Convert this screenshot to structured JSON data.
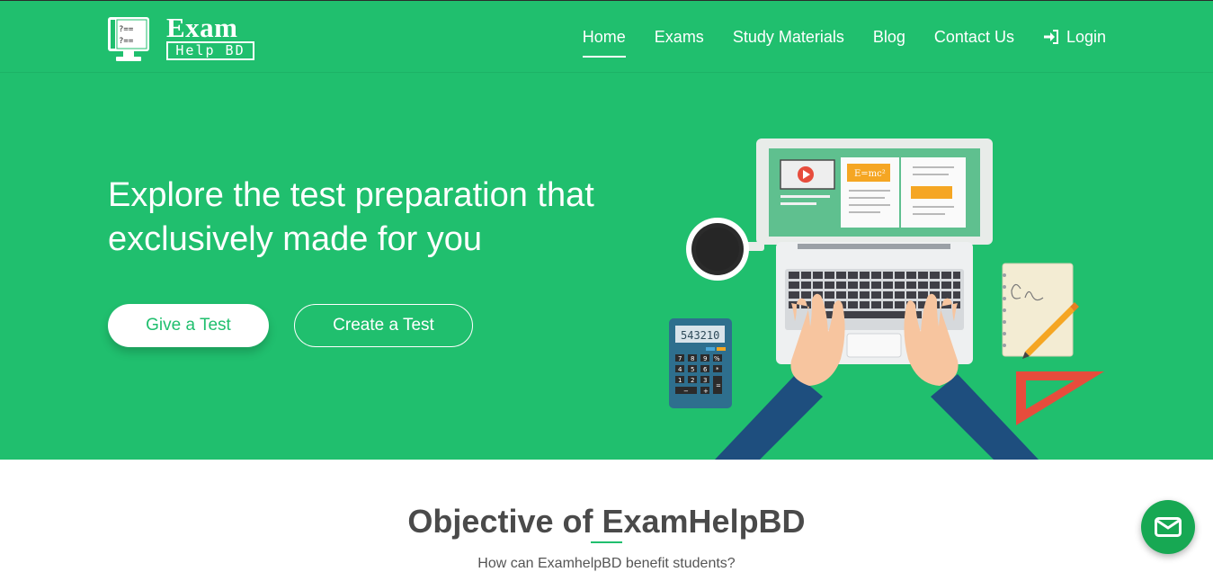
{
  "brand": {
    "word_top": "Exam",
    "word_bottom": "Help BD",
    "primary_color": "#20bf6e"
  },
  "nav": {
    "items": [
      {
        "label": "Home",
        "active": true
      },
      {
        "label": "Exams",
        "active": false
      },
      {
        "label": "Study Materials",
        "active": false
      },
      {
        "label": "Blog",
        "active": false
      },
      {
        "label": "Contact Us",
        "active": false
      }
    ],
    "login_label": "Login",
    "login_icon": "sign-in-icon"
  },
  "hero": {
    "title": "Explore the test preparation that exclusively made for you",
    "give_test_label": "Give a Test",
    "create_test_label": "Create a Test",
    "illustration": {
      "calculator_display": "543210",
      "formula": "E=mc²",
      "calculator_keys": [
        "7",
        "8",
        "9",
        "%",
        "4",
        "5",
        "6",
        "*",
        "1",
        "2",
        "3",
        "=",
        "−",
        "+"
      ]
    }
  },
  "objective": {
    "title_strong": "Objective",
    "title_rest": " of ExamHelpBD",
    "subtitle": "How can ExamhelpBD benefit students?"
  },
  "fab": {
    "icon": "mail-icon"
  }
}
